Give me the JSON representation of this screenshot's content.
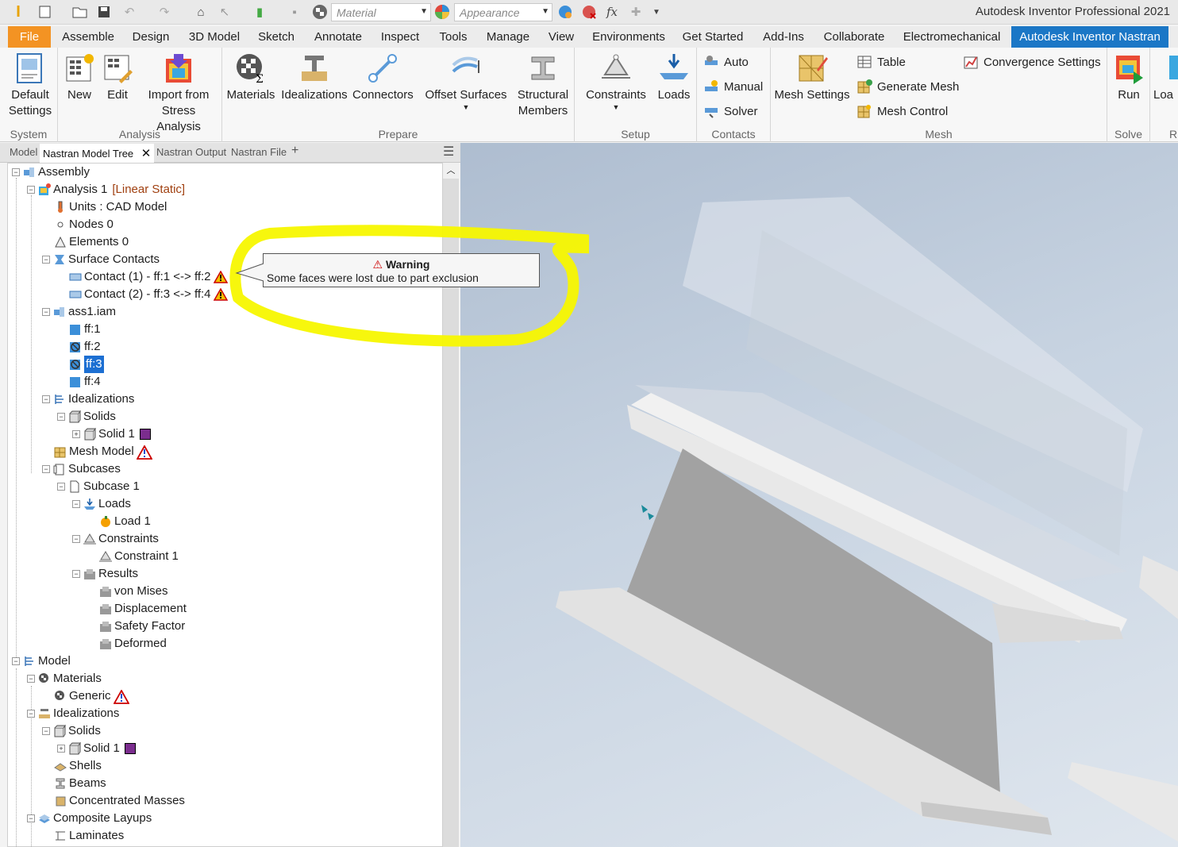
{
  "quick_access": {
    "material_placeholder": "Material",
    "appearance_placeholder": "Appearance",
    "icons": [
      "inventor-logo-icon",
      "new-icon",
      "open-icon",
      "save-icon",
      "undo-icon",
      "redo-icon",
      "home-icon",
      "select-icon",
      "update-icon",
      "measure-icon",
      "material-icon",
      "appearance-icon",
      "adjust-icon",
      "clear-icon",
      "fx-icon",
      "plus-icon"
    ]
  },
  "app_title": "Autodesk Inventor Professional 2021",
  "tabs": [
    "File",
    "Assemble",
    "Design",
    "3D Model",
    "Sketch",
    "Annotate",
    "Inspect",
    "Tools",
    "Manage",
    "View",
    "Environments",
    "Get Started",
    "Add-Ins",
    "Collaborate",
    "Electromechanical",
    "Autodesk Inventor Nastran"
  ],
  "ribbon": {
    "groups": {
      "system": "System",
      "analysis": "Analysis",
      "prepare": "Prepare",
      "setup": "Setup",
      "contacts": "Contacts",
      "mesh": "Mesh",
      "solve": "Solve",
      "partial": "R"
    },
    "buttons": {
      "default_settings_1": "Default",
      "default_settings_2": "Settings",
      "new": "New",
      "edit": "Edit",
      "import_1": "Import from",
      "import_2": "Stress Analysis",
      "materials": "Materials",
      "idealizations": "Idealizations",
      "connectors": "Connectors",
      "offset_surfaces": "Offset Surfaces",
      "structural_1": "Structural",
      "structural_2": "Members",
      "constraints": "Constraints",
      "loads": "Loads",
      "auto": "Auto",
      "manual": "Manual",
      "solver": "Solver",
      "mesh_settings": "Mesh Settings",
      "table": "Table",
      "generate_mesh": "Generate Mesh",
      "mesh_control": "Mesh Control",
      "convergence": "Convergence Settings",
      "run": "Run",
      "load_partial": "Loa"
    }
  },
  "panel_tabs": {
    "model": "Model",
    "tree": "Nastran Model Tree",
    "output": "Nastran Output",
    "file": "Nastran File",
    "add": "+"
  },
  "tree": {
    "assembly": "Assembly",
    "analysis": "Analysis 1",
    "analysis_type": "[Linear Static]",
    "units": "Units : CAD Model",
    "nodes": "Nodes 0",
    "elements": "Elements 0",
    "surface_contacts": "Surface Contacts",
    "contact1": "Contact (1) - ff:1 <-> ff:2",
    "contact2": "Contact (2) - ff:3 <-> ff:4",
    "ass1": "ass1.iam",
    "ff1": "ff:1",
    "ff2": "ff:2",
    "ff3": "ff:3",
    "ff4": "ff:4",
    "idealizations": "Idealizations",
    "solids": "Solids",
    "solid1": "Solid 1",
    "mesh_model": "Mesh Model",
    "subcases": "Subcases",
    "subcase1": "Subcase 1",
    "loads": "Loads",
    "load1": "Load 1",
    "constraints": "Constraints",
    "constraint1": "Constraint 1",
    "results": "Results",
    "von_mises": "von Mises",
    "displacement": "Displacement",
    "safety_factor": "Safety Factor",
    "deformed": "Deformed",
    "model": "Model",
    "materials": "Materials",
    "generic": "Generic",
    "idealizations2": "Idealizations",
    "solids2": "Solids",
    "solid1b": "Solid 1",
    "shells": "Shells",
    "beams": "Beams",
    "masses": "Concentrated Masses",
    "composite": "Composite Layups",
    "laminates": "Laminates"
  },
  "tooltip": {
    "title": "Warning",
    "message": "Some faces were lost due to part exclusion"
  },
  "colors": {
    "solid_swatch": "#7b2d8e",
    "highlight": "#f7f700",
    "accent": "#1b77c6",
    "file_tab": "#f39323"
  }
}
